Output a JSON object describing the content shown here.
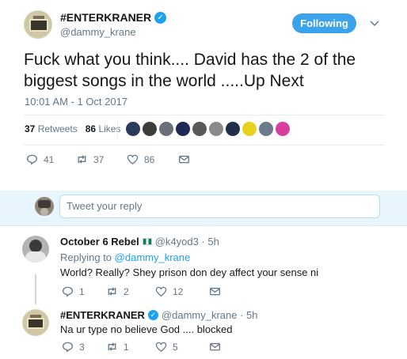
{
  "tweet": {
    "author_name": "#ENTERKRANER",
    "author_handle": "@dammy_krane",
    "follow_label": "Following",
    "text": "Fuck what you think.... David has the 2 of the biggest songs in the world .....Up Next",
    "timestamp": "10:01 AM - 1 Oct 2017",
    "retweets_count": "37",
    "retweets_label": "Retweets",
    "likes_count": "86",
    "likes_label": "Likes",
    "reply_count": "41",
    "retweet_count": "37",
    "like_count": "86"
  },
  "reply_box": {
    "placeholder": "Tweet your reply"
  },
  "replies": [
    {
      "name": "October 6 Rebel",
      "handle": "@k4yod3 · 5h",
      "replying_prefix": "Replying to",
      "replying_to": "@dammy_krane",
      "text": "World? Really? Shey prison don dey affect your sense ni",
      "reply_count": "1",
      "retweet_count": "2",
      "like_count": "12"
    },
    {
      "name": "#ENTERKRANER",
      "handle": "@dammy_krane · 5h",
      "text": "Na ur type no believe God .... blocked",
      "reply_count": "3",
      "retweet_count": "1",
      "like_count": "5"
    }
  ],
  "colors": {
    "accent": "#1da1f2",
    "follow_button": "#3ba3ec",
    "reply_box_bg": "#e8f5fd",
    "muted_text": "#657786"
  },
  "liker_avatar_colors": [
    "#2b3a5c",
    "#3d3d3d",
    "#6b6f7a",
    "#1e2a55",
    "#595959",
    "#8a8a8a",
    "#1f2f4a",
    "#e8d21d",
    "#6a7a8a",
    "#d63fa0"
  ]
}
